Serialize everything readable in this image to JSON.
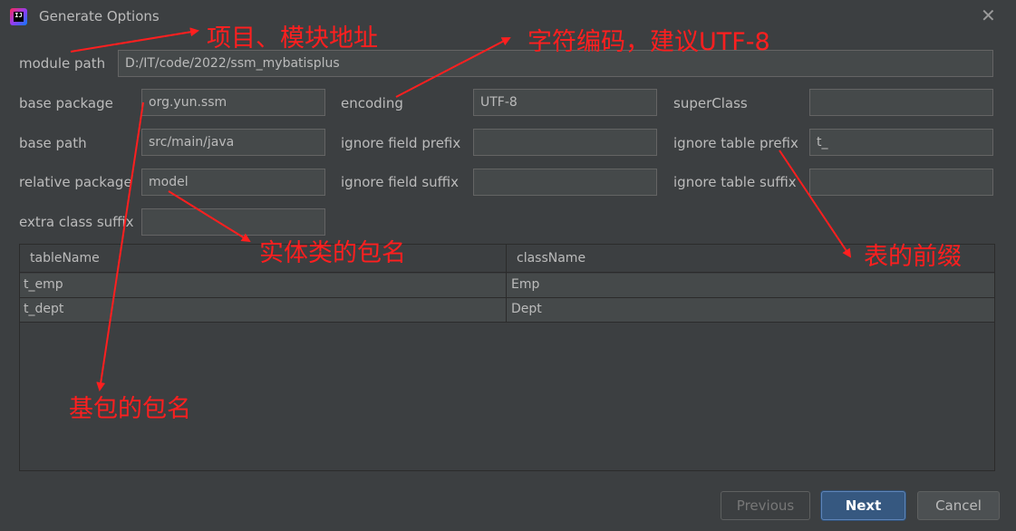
{
  "dialog": {
    "title": "Generate Options",
    "close_label": "✕"
  },
  "form": {
    "module_path": {
      "label": "module path",
      "value": "D:/IT/code/2022/ssm_mybatisplus"
    },
    "base_package": {
      "label": "base package",
      "value": "org.yun.ssm"
    },
    "base_path": {
      "label": "base path",
      "value": "src/main/java"
    },
    "relative_package": {
      "label": "relative package",
      "value": "model"
    },
    "extra_class_suffix": {
      "label": "extra class suffix",
      "value": ""
    },
    "encoding": {
      "label": "encoding",
      "value": "UTF-8"
    },
    "ignore_field_prefix": {
      "label": "ignore field prefix",
      "value": ""
    },
    "ignore_field_suffix": {
      "label": "ignore field suffix",
      "value": ""
    },
    "super_class": {
      "label": "superClass",
      "value": ""
    },
    "ignore_table_prefix": {
      "label": "ignore table prefix",
      "value": "t_"
    },
    "ignore_table_suffix": {
      "label": "ignore table suffix",
      "value": ""
    }
  },
  "table": {
    "headers": [
      "tableName",
      "className"
    ],
    "rows": [
      [
        "t_emp",
        "Emp"
      ],
      [
        "t_dept",
        "Dept"
      ]
    ]
  },
  "buttons": {
    "previous": "Previous",
    "next": "Next",
    "cancel": "Cancel"
  },
  "annotations": {
    "module_address": "项目、模块地址",
    "encoding_note": "字符编码，建议UTF-8",
    "entity_package": "实体类的包名",
    "table_prefix": "表的前缀",
    "base_package_name": "基包的包名"
  },
  "colors": {
    "annotation": "#ff1f1f",
    "background": "#3c3f41",
    "field": "#45494a",
    "accent": "#365880"
  },
  "icons": {
    "app": "intellij-idea-icon",
    "close": "close-icon"
  }
}
